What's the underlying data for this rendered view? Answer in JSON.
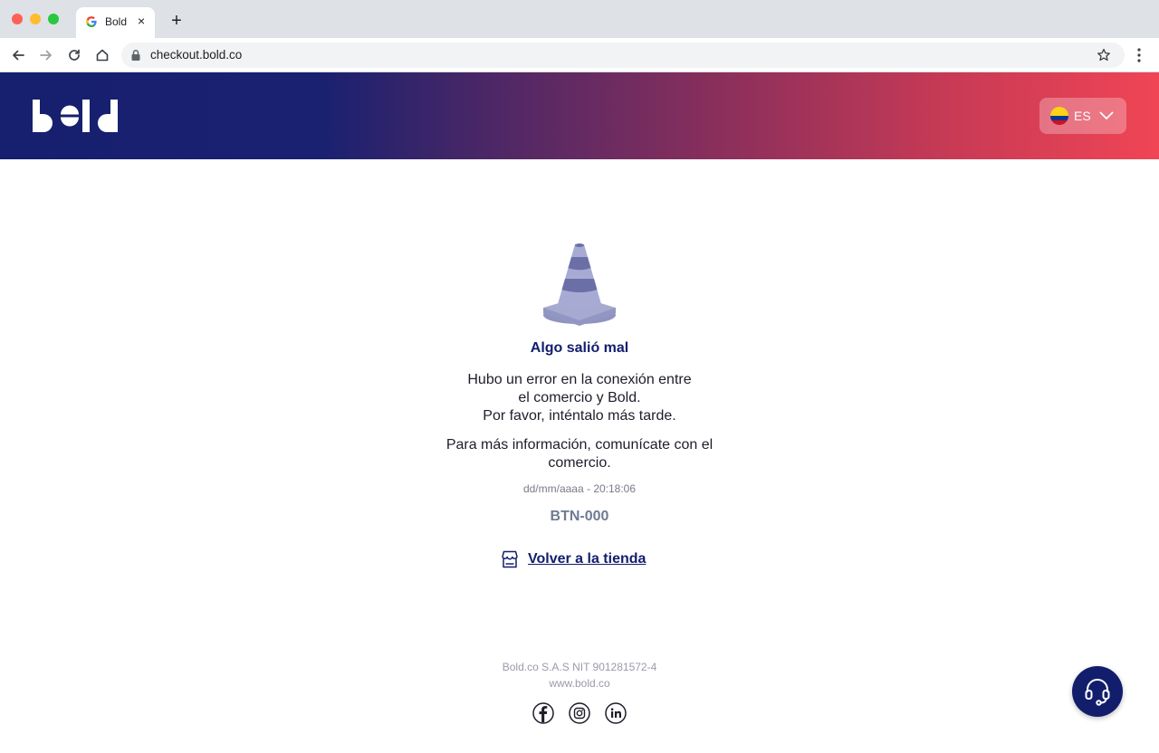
{
  "browser": {
    "tab_title": "Bold",
    "tab_close": "×",
    "new_tab": "+",
    "url": "checkout.bold.co"
  },
  "header": {
    "logo_text": "bold",
    "language": {
      "code": "ES",
      "flag_icon": "colombia-flag-icon"
    },
    "colors": {
      "gradient_start": "#16206e",
      "gradient_end": "#f04555"
    }
  },
  "error": {
    "title": "Algo salió mal",
    "message_lines": [
      "Hubo un error en la conexión entre",
      "el comercio y Bold.",
      "Por favor, inténtalo más tarde."
    ],
    "info_lines": [
      "Para más información, comunícate con el",
      "comercio."
    ],
    "timestamp": "dd/mm/aaaa - 20:18:06",
    "code": "BTN-000",
    "back_link": "Volver a la tienda",
    "illustration": "traffic-cone-icon"
  },
  "footer": {
    "company": "Bold.co S.A.S NIT 901281572-4",
    "website": "www.bold.co",
    "social": [
      "facebook-icon",
      "instagram-icon",
      "linkedin-icon"
    ],
    "support_icon": "headset-icon"
  }
}
